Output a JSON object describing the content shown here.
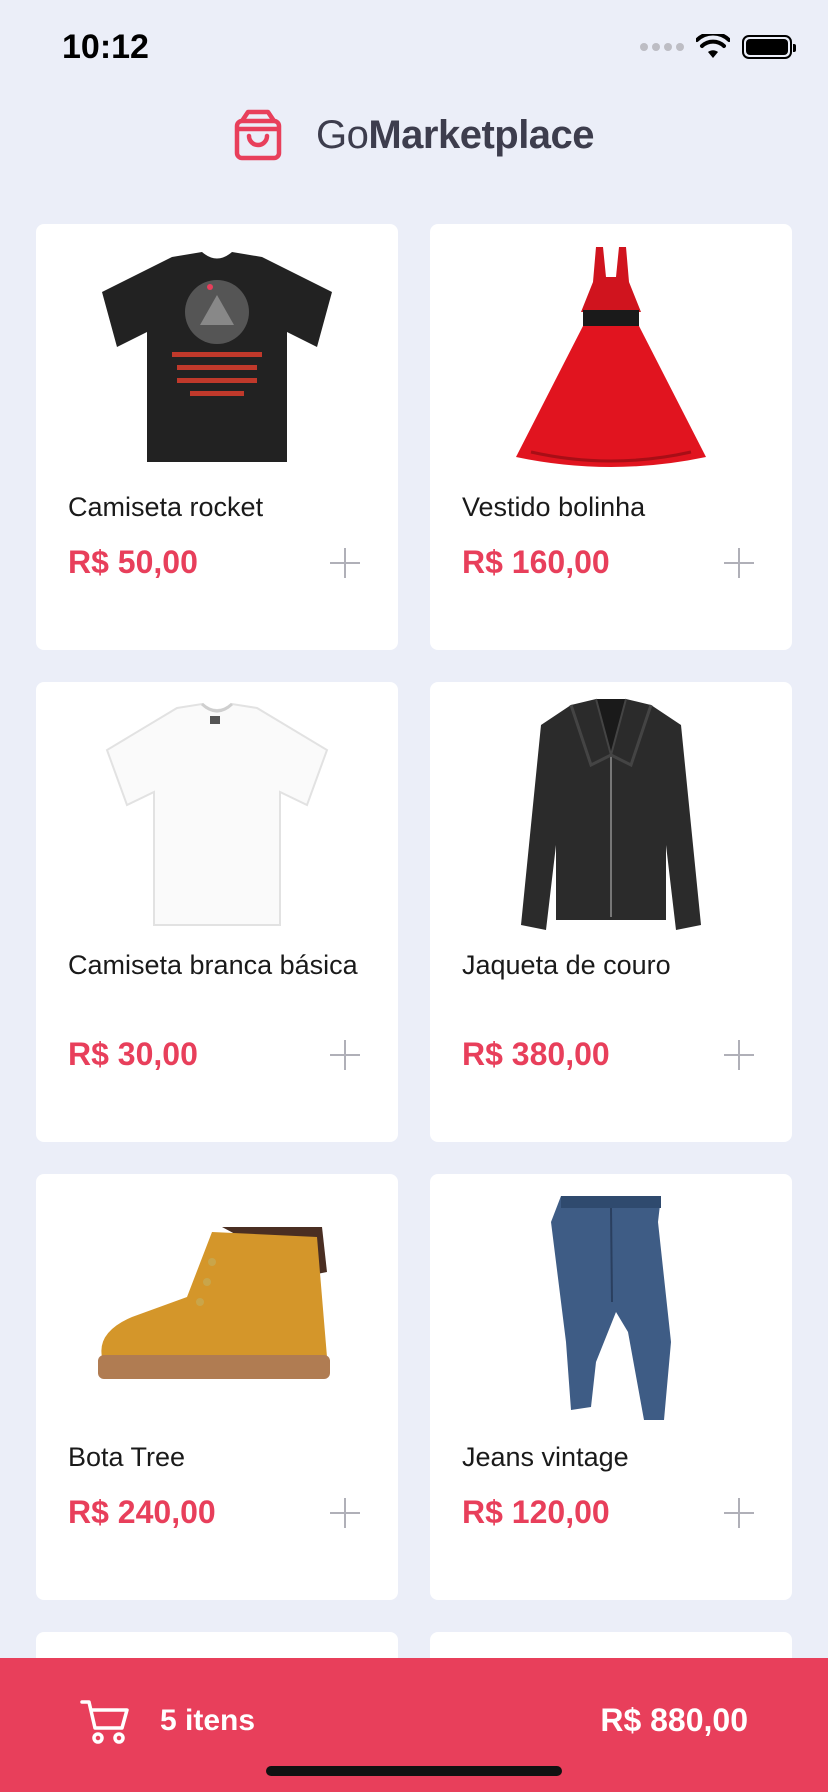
{
  "status_bar": {
    "time": "10:12"
  },
  "header": {
    "title_light": "Go",
    "title_bold": "Marketplace"
  },
  "products": [
    {
      "name": "Camiseta rocket",
      "price": "R$ 50,00",
      "image": "black-tshirt"
    },
    {
      "name": "Vestido bolinha",
      "price": "R$ 160,00",
      "image": "red-dress"
    },
    {
      "name": "Camiseta branca básica",
      "price": "R$ 30,00",
      "image": "white-tshirt"
    },
    {
      "name": "Jaqueta de couro",
      "price": "R$ 380,00",
      "image": "leather-jacket"
    },
    {
      "name": "Bota Tree",
      "price": "R$ 240,00",
      "image": "boot"
    },
    {
      "name": "Jeans vintage",
      "price": "R$ 120,00",
      "image": "jeans"
    }
  ],
  "cart": {
    "count_label": "5 itens",
    "total": "R$ 880,00"
  },
  "colors": {
    "accent": "#E83F5B",
    "background": "#EBEEF8",
    "text_dark": "#3D3D4D"
  }
}
